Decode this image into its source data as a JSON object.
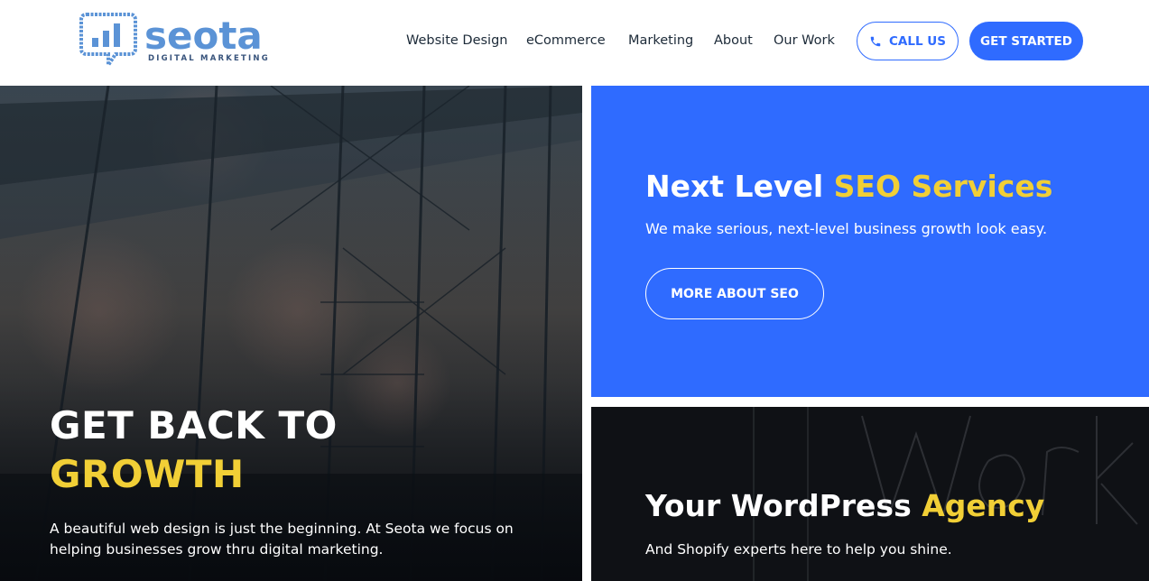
{
  "brand": {
    "name": "seota",
    "tagline": "DIGITAL MARKETING",
    "color_light": "#5b93d6",
    "color_dark": "#39547c"
  },
  "nav": {
    "items": [
      {
        "label": "Website Design"
      },
      {
        "label": "eCommerce"
      },
      {
        "label": "Marketing"
      },
      {
        "label": "About"
      },
      {
        "label": "Our Work"
      }
    ]
  },
  "header_actions": {
    "call_label": "CALL US",
    "call_icon": "phone-icon",
    "start_label": "GET STARTED"
  },
  "hero": {
    "title_line1": "GET BACK TO",
    "title_line2": "GROWTH",
    "text": "A beautiful web design is just the beginning. At Seota we focus on helping businesses grow thru digital marketing."
  },
  "seo_card": {
    "title_main": "Next Level ",
    "title_accent": "SEO Services",
    "subtitle": "We make serious, next-level business growth look easy.",
    "button_label": "MORE ABOUT SEO"
  },
  "wp_card": {
    "title_main": "Your WordPress ",
    "title_accent": "Agency",
    "subtitle": "And Shopify experts here to help you shine."
  },
  "colors": {
    "primary_blue": "#2f6bff",
    "accent_yellow": "#f1cf36",
    "nav_text": "#1c2a38",
    "dark_card": "#0f1115"
  }
}
